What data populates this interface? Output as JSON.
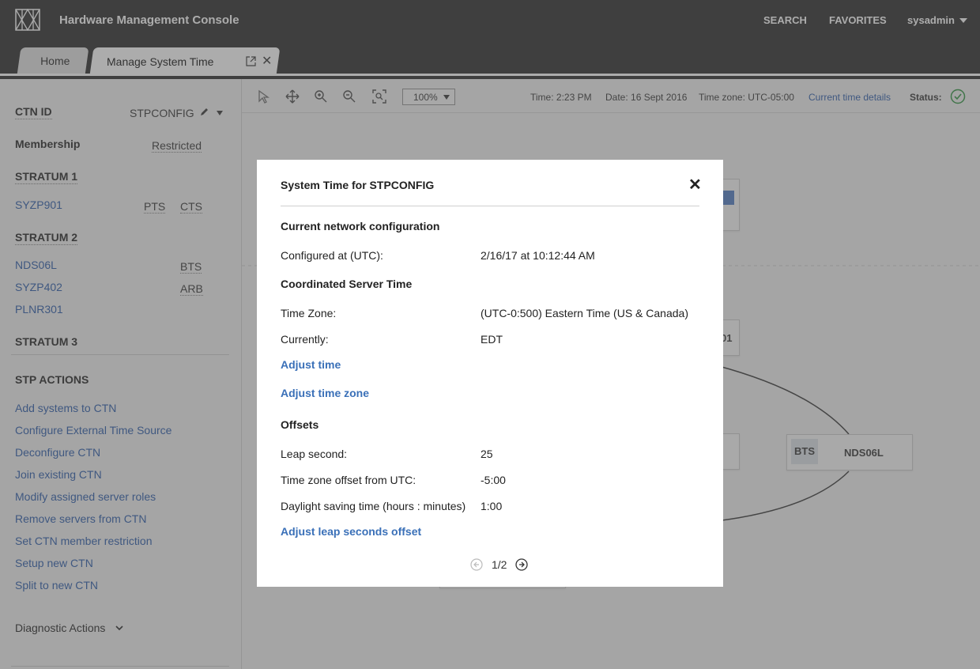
{
  "header": {
    "app_title": "Hardware Management Console",
    "search": "SEARCH",
    "favorites": "FAVORITES",
    "user": "sysadmin"
  },
  "tabs": [
    {
      "label": "Home"
    },
    {
      "label": "Manage System Time"
    }
  ],
  "sidebar": {
    "ctn_id_label": "CTN ID",
    "ctn_id_value": "STPCONFIG",
    "membership_label": "Membership",
    "membership_value": "Restricted",
    "stratum1": {
      "label": "STRATUM 1",
      "systems": [
        {
          "name": "SYZP901",
          "roles": [
            "PTS",
            "CTS"
          ]
        }
      ]
    },
    "stratum2": {
      "label": "STRATUM 2",
      "systems": [
        {
          "name": "NDS06L",
          "role": "BTS"
        },
        {
          "name": "SYZP402",
          "role": "ARB"
        },
        {
          "name": "PLNR301",
          "role": ""
        }
      ]
    },
    "stratum3": {
      "label": "STRATUM 3"
    },
    "actions_label": "STP ACTIONS",
    "actions": [
      "Add systems to CTN",
      "Configure External Time Source",
      "Deconfigure CTN",
      "Join existing CTN",
      "Modify assigned server roles",
      "Remove servers from CTN",
      "Set CTN member restriction",
      "Setup new CTN",
      "Split to new CTN"
    ],
    "diagnostic": "Diagnostic Actions"
  },
  "toolbar": {
    "zoom": "100%",
    "time": "Time: 2:23 PM",
    "date": "Date: 16 Sept 2016",
    "timezone": "Time zone: UTC-05:00",
    "details_link": "Current time details",
    "status_label": "Status:"
  },
  "canvas": {
    "node_partial_label": "01",
    "node_bts": {
      "role": "BTS",
      "name": "NDS06L"
    }
  },
  "modal": {
    "title": "System Time for STPCONFIG",
    "section_network": "Current network configuration",
    "configured_key": "Configured at (UTC):",
    "configured_val": "2/16/17 at 10:12:44 AM",
    "section_cst": "Coordinated Server Time",
    "tz_key": "Time Zone:",
    "tz_val": "(UTC-0:500) Eastern Time (US & Canada)",
    "currently_key": "Currently:",
    "currently_val": "EDT",
    "adjust_time": "Adjust time",
    "adjust_tz": "Adjust time zone",
    "section_offsets": "Offsets",
    "leap_key": "Leap second:",
    "leap_val": "25",
    "tzoff_key": "Time zone offset from UTC:",
    "tzoff_val": "-5:00",
    "dst_key": "Daylight saving time (hours : minutes)",
    "dst_val": "1:00",
    "adjust_leap": "Adjust leap seconds offset",
    "pager": "1/2"
  },
  "colors": {
    "header_bg": "#3a3a3a",
    "link": "#3a66b0",
    "status_ok": "#3c9b4e"
  }
}
